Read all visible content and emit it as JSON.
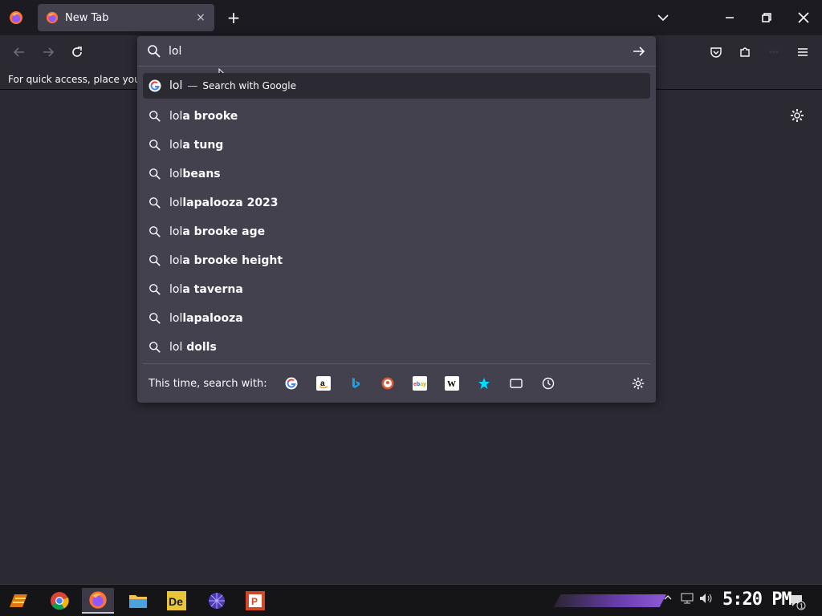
{
  "tab": {
    "title": "New Tab",
    "close": "×"
  },
  "new_tab": "+",
  "bookmarks_bar": {
    "text": "For quick access, place your b"
  },
  "url": {
    "value": "lol",
    "first_result": {
      "text": "lol",
      "separator": "—",
      "action": "Search with Google"
    },
    "suggestions": [
      {
        "typed": "lol",
        "rest": "a brooke"
      },
      {
        "typed": "lol",
        "rest": "a tung"
      },
      {
        "typed": "lol",
        "rest": "beans"
      },
      {
        "typed": "lol",
        "rest": "lapalooza 2023"
      },
      {
        "typed": "lol",
        "rest": "a brooke age"
      },
      {
        "typed": "lol",
        "rest": "a brooke height"
      },
      {
        "typed": "lol",
        "rest": "a taverna"
      },
      {
        "typed": "lol",
        "rest": "lapalooza"
      },
      {
        "typed": "lol",
        "rest": " dolls"
      }
    ],
    "one_off_label": "This time, search with:",
    "engines": [
      "google-icon",
      "amazon-icon",
      "bing-icon",
      "duckduckgo-icon",
      "ebay-icon",
      "wikipedia-icon",
      "bookmarks-icon",
      "tabs-icon",
      "history-icon"
    ]
  },
  "taskbar": {
    "clock": "5:20 PM",
    "notification_count": "1"
  },
  "colors": {
    "toolbar": "#2b2a33",
    "tabstrip": "#1c1b22",
    "panel": "#42414d",
    "accent": "#8e5ad6"
  }
}
